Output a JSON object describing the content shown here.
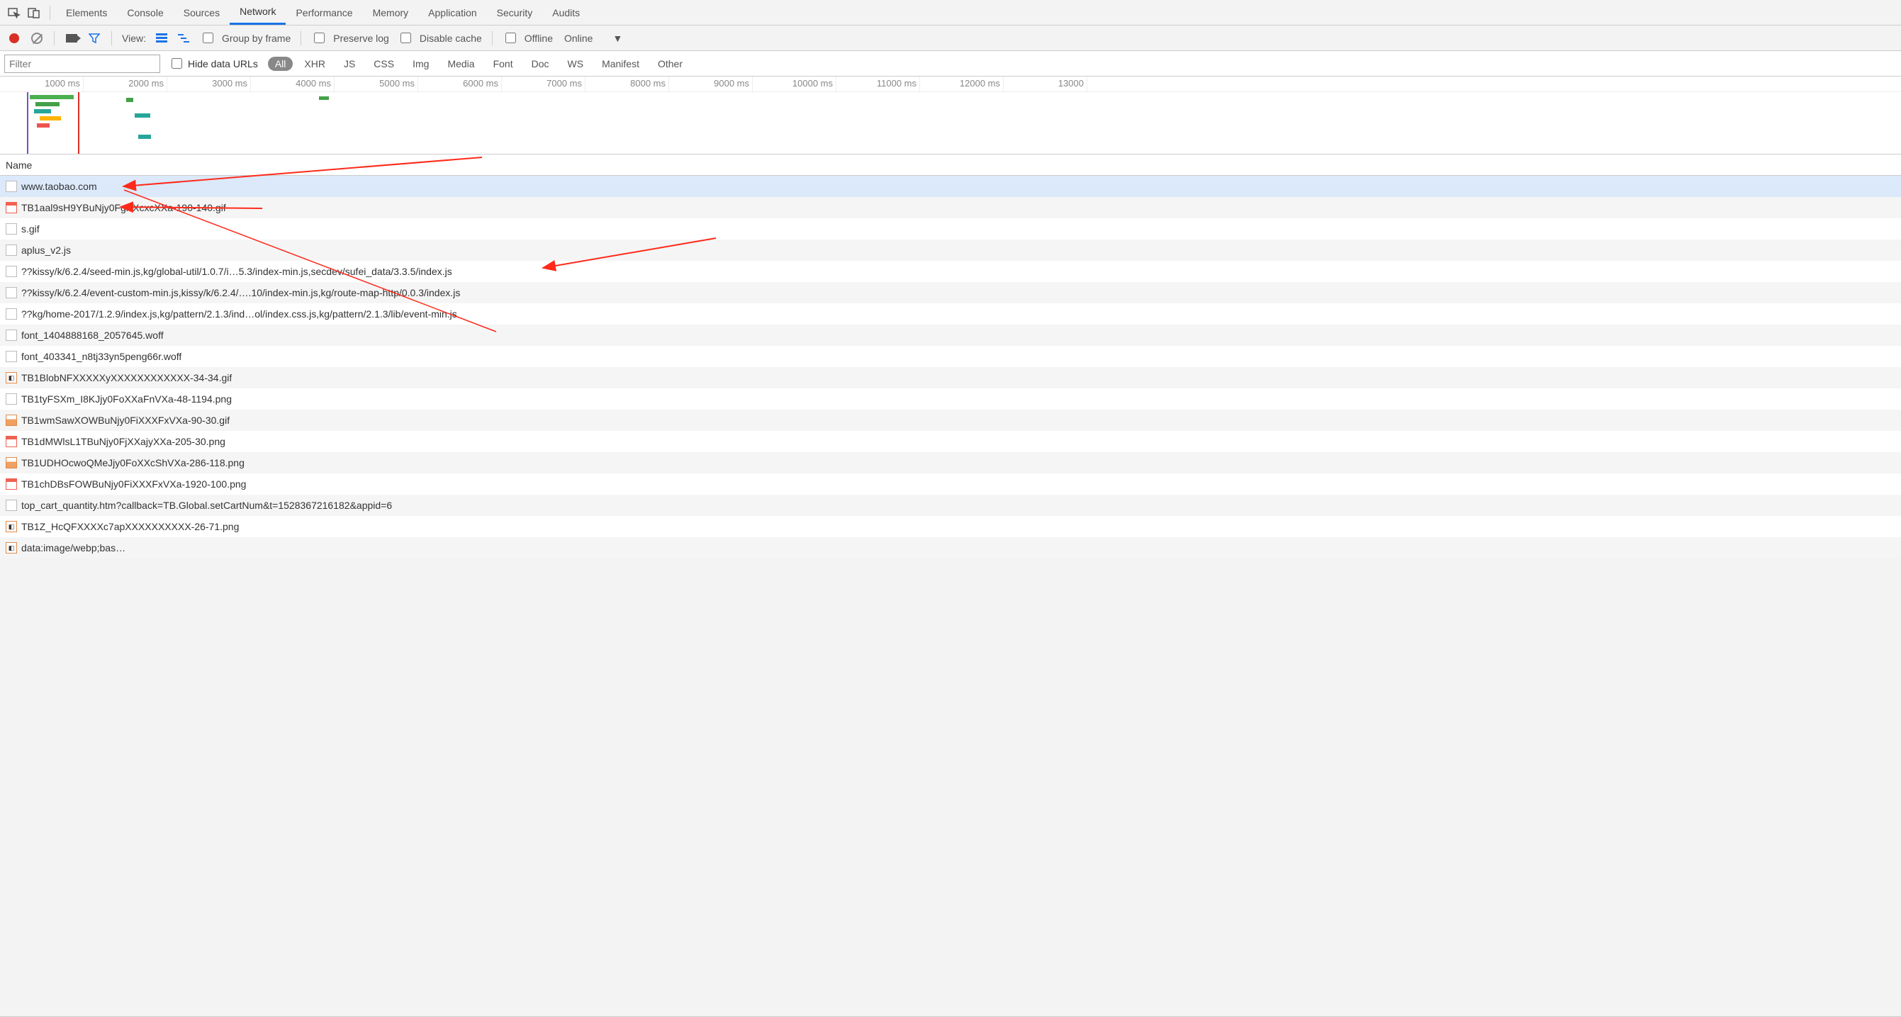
{
  "tabs": [
    "Elements",
    "Console",
    "Sources",
    "Network",
    "Performance",
    "Memory",
    "Application",
    "Security",
    "Audits"
  ],
  "active_tab": "Network",
  "toolbar": {
    "view_label": "View:",
    "group_by_frame": "Group by frame",
    "preserve_log": "Preserve log",
    "disable_cache": "Disable cache",
    "offline": "Offline",
    "online": "Online"
  },
  "filter": {
    "placeholder": "Filter",
    "hide_data_urls": "Hide data URLs",
    "types": [
      "All",
      "XHR",
      "JS",
      "CSS",
      "Img",
      "Media",
      "Font",
      "Doc",
      "WS",
      "Manifest",
      "Other"
    ],
    "active_type": "All"
  },
  "timeline": {
    "ticks": [
      "1000 ms",
      "2000 ms",
      "3000 ms",
      "4000 ms",
      "5000 ms",
      "6000 ms",
      "7000 ms",
      "8000 ms",
      "9000 ms",
      "10000 ms",
      "11000 ms",
      "12000 ms",
      "13000"
    ]
  },
  "columns": {
    "name": "Name"
  },
  "requests": [
    {
      "name": "www.taobao.com",
      "icon": "doc",
      "selected": true
    },
    {
      "name": "TB1aal9sH9YBuNjy0FgXXcxcXXa-190-140.gif",
      "icon": "imgtop"
    },
    {
      "name": "s.gif",
      "icon": "doc"
    },
    {
      "name": "aplus_v2.js",
      "icon": "doc"
    },
    {
      "name": "??kissy/k/6.2.4/seed-min.js,kg/global-util/1.0.7/i…5.3/index-min.js,secdev/sufei_data/3.3.5/index.js",
      "icon": "doc"
    },
    {
      "name": "??kissy/k/6.2.4/event-custom-min.js,kissy/k/6.2.4/….10/index-min.js,kg/route-map-http/0.0.3/index.js",
      "icon": "doc"
    },
    {
      "name": "??kg/home-2017/1.2.9/index.js,kg/pattern/2.1.3/ind…ol/index.css.js,kg/pattern/2.1.3/lib/event-min.js",
      "icon": "doc"
    },
    {
      "name": "font_1404888168_2057645.woff",
      "icon": "doc"
    },
    {
      "name": "font_403341_n8tj33yn5peng66r.woff",
      "icon": "doc"
    },
    {
      "name": "TB1BlobNFXXXXXyXXXXXXXXXXXX-34-34.gif",
      "icon": "img"
    },
    {
      "name": "TB1tyFSXm_I8KJjy0FoXXaFnVXa-48-1194.png",
      "icon": "doc"
    },
    {
      "name": "TB1wmSawXOWBuNjy0FiXXXFxVXa-90-30.gif",
      "icon": "imgfill"
    },
    {
      "name": "TB1dMWlsL1TBuNjy0FjXXajyXXa-205-30.png",
      "icon": "imgtop"
    },
    {
      "name": "TB1UDHOcwoQMeJjy0FoXXcShVXa-286-118.png",
      "icon": "imgfill"
    },
    {
      "name": "TB1chDBsFOWBuNjy0FiXXXFxVXa-1920-100.png",
      "icon": "imgtop"
    },
    {
      "name": "top_cart_quantity.htm?callback=TB.Global.setCartNum&t=1528367216182&appid=6",
      "icon": "doc"
    },
    {
      "name": "TB1Z_HcQFXXXXc7apXXXXXXXXXX-26-71.png",
      "icon": "img"
    },
    {
      "name": "data:image/webp;bas…",
      "icon": "img"
    }
  ]
}
